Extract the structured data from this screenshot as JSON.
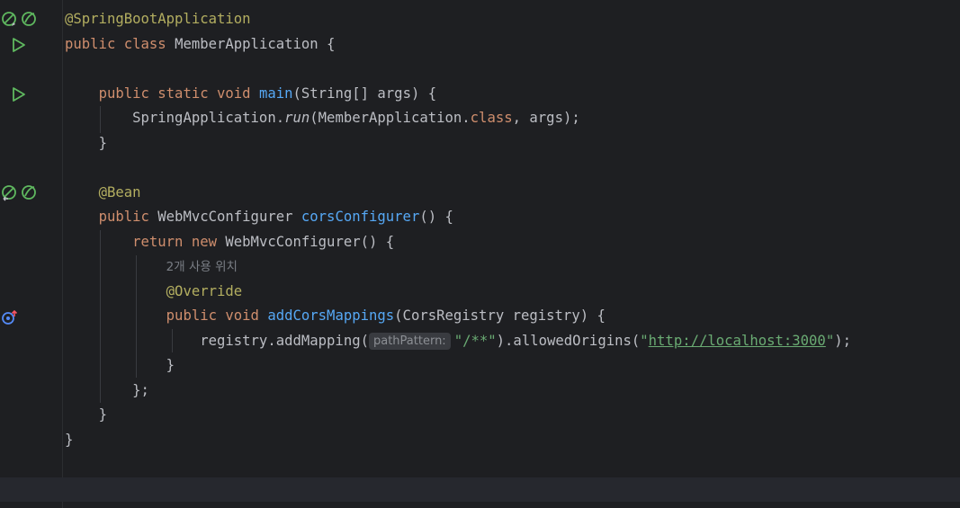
{
  "gutter": {
    "icons": {
      "bean_icon": "spring-bean-icon",
      "run_icon": "run-icon",
      "override_icon": "override-method-icon"
    }
  },
  "colors": {
    "background": "#1e1f22",
    "keyword": "#cf8e6d",
    "annotation": "#b3ae60",
    "function": "#56a8f5",
    "string": "#6aab73",
    "default": "#bcbec4"
  },
  "code": {
    "l1": {
      "annotation": "@SpringBootApplication"
    },
    "l2": {
      "kw": "public class ",
      "name": "MemberApplication {"
    },
    "l4": {
      "indent": "    ",
      "kw": "public static void ",
      "fn": "main",
      "rest": "(String[] args) {"
    },
    "l5": {
      "indent": "        ",
      "pre": "SpringApplication.",
      "it": "run",
      "mid": "(MemberApplication.",
      "kw": "class",
      "post": ", args);"
    },
    "l6": {
      "indent": "    ",
      "text": "}"
    },
    "l8": {
      "indent": "    ",
      "annotation": "@Bean"
    },
    "l9": {
      "indent": "    ",
      "kw": "public ",
      "type": "WebMvcConfigurer ",
      "fn": "corsConfigurer",
      "rest": "() {"
    },
    "l10": {
      "indent": "        ",
      "kw": "return new ",
      "rest": "WebMvcConfigurer() {"
    },
    "l11": {
      "indent": "            ",
      "usages": "2개 사용 위치"
    },
    "l12": {
      "indent": "            ",
      "annotation": "@Override"
    },
    "l13": {
      "indent": "            ",
      "kw": "public void ",
      "fn": "addCorsMappings",
      "rest": "(CorsRegistry registry) {"
    },
    "l14": {
      "indent": "                ",
      "pre": "registry.addMapping(",
      "hint": "pathPattern:",
      "str1": "\"/**\"",
      "mid": ").allowedOrigins(",
      "q1": "\"",
      "link": "http://localhost:3000",
      "q2": "\"",
      "post": ");"
    },
    "l15": {
      "indent": "            ",
      "text": "}"
    },
    "l16": {
      "indent": "        ",
      "text": "};"
    },
    "l17": {
      "indent": "    ",
      "text": "}"
    },
    "l18": {
      "text": "}"
    }
  }
}
